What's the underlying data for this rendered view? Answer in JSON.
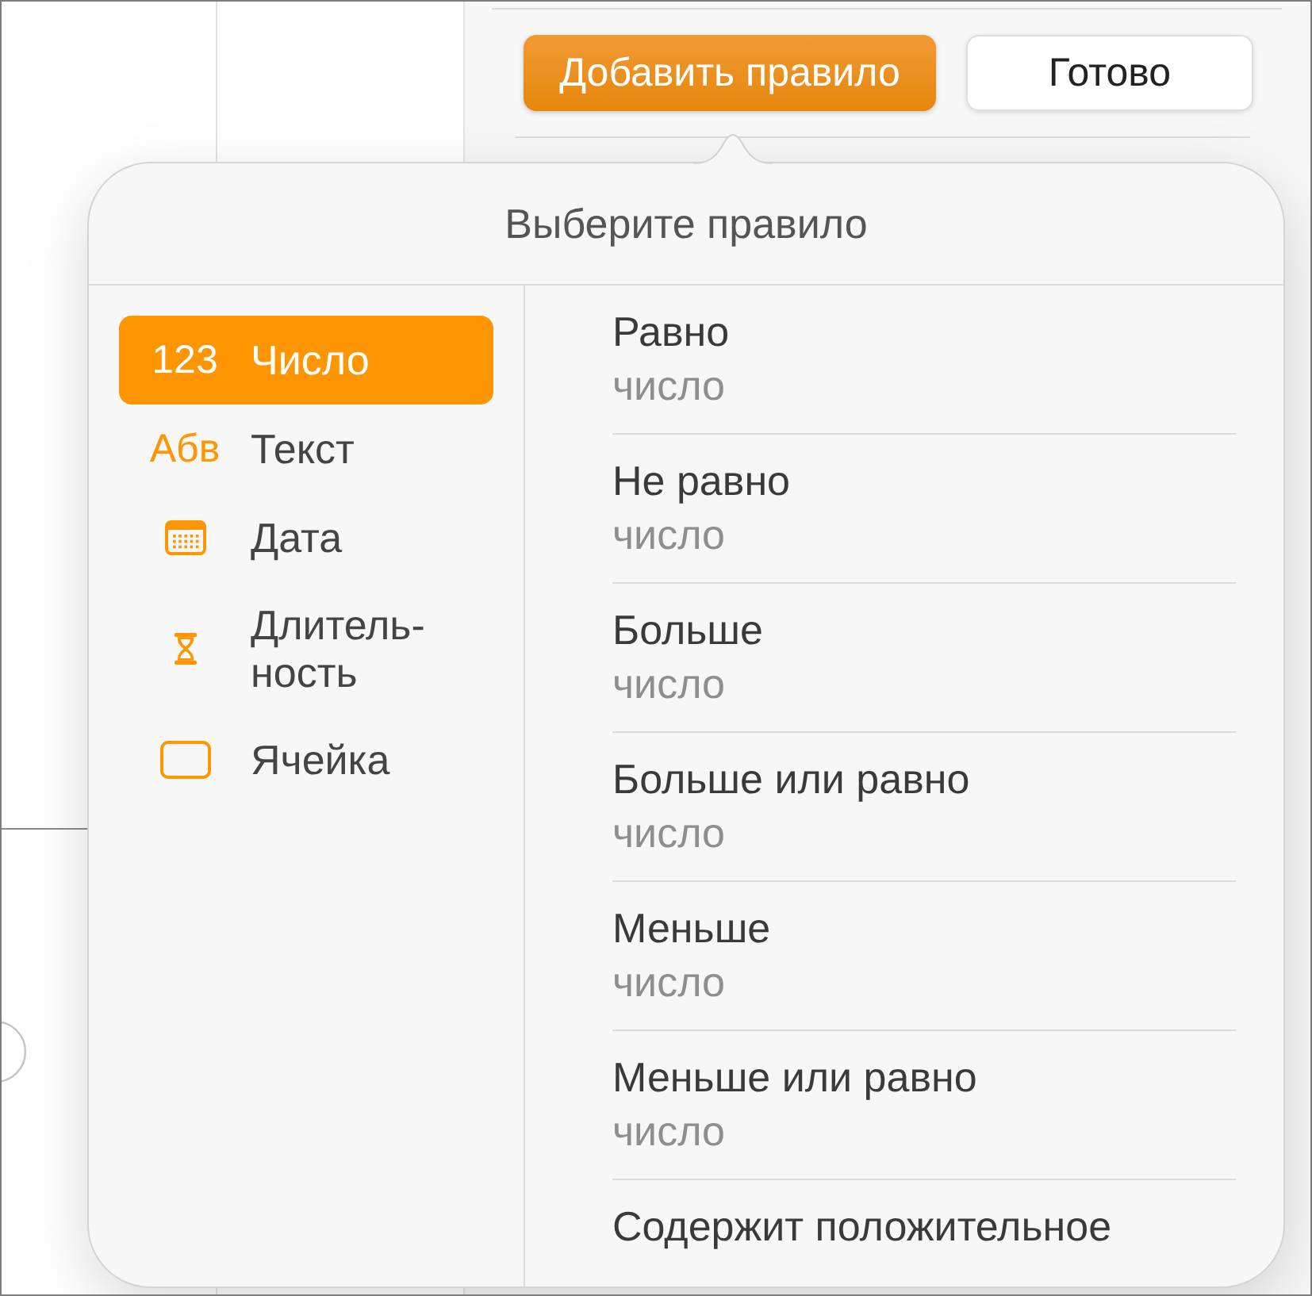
{
  "toolbar": {
    "buttons": [
      {
        "label": "Добавить правило",
        "kind": "primary"
      },
      {
        "label": "Готово",
        "kind": "secondary"
      }
    ]
  },
  "popover": {
    "title": "Выберите правило",
    "categories": [
      {
        "kind": "glyph",
        "glyph": "123",
        "label": "Число",
        "selected": true
      },
      {
        "kind": "glyph",
        "glyph": "Абв",
        "label": "Текст",
        "selected": false
      },
      {
        "kind": "calendar",
        "label": "Дата",
        "selected": false
      },
      {
        "kind": "hourglass",
        "label": "Длитель-\nность",
        "selected": false
      },
      {
        "kind": "cell",
        "label": "Ячейка",
        "selected": false
      }
    ],
    "rules": [
      {
        "title": "Равно",
        "detail": "число"
      },
      {
        "title": "Не равно",
        "detail": "число"
      },
      {
        "title": "Больше",
        "detail": "число"
      },
      {
        "title": "Больше или равно",
        "detail": "число"
      },
      {
        "title": "Меньше",
        "detail": "число"
      },
      {
        "title": "Меньше или равно",
        "detail": "число"
      },
      {
        "title": "Содержит положительное"
      }
    ]
  }
}
